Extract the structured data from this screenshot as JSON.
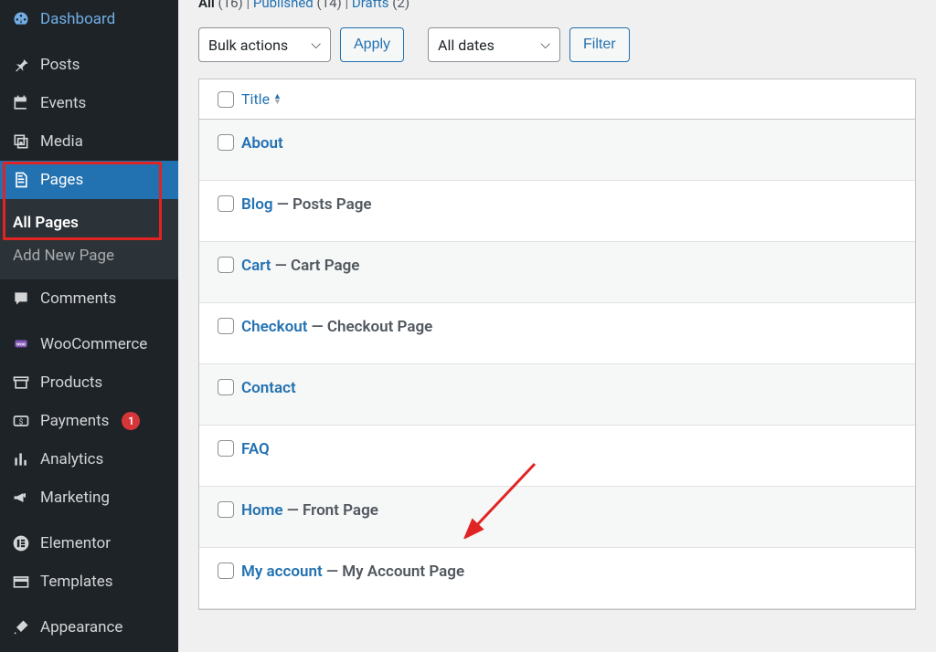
{
  "sidebar": {
    "items": [
      {
        "id": "dashboard",
        "label": "Dashboard",
        "icon": "gauge"
      },
      {
        "id": "posts",
        "label": "Posts",
        "icon": "pin"
      },
      {
        "id": "events",
        "label": "Events",
        "icon": "calendar"
      },
      {
        "id": "media",
        "label": "Media",
        "icon": "media"
      },
      {
        "id": "pages",
        "label": "Pages",
        "icon": "pages"
      },
      {
        "id": "comments",
        "label": "Comments",
        "icon": "comment"
      },
      {
        "id": "woocommerce",
        "label": "WooCommerce",
        "icon": "woo"
      },
      {
        "id": "products",
        "label": "Products",
        "icon": "archive"
      },
      {
        "id": "payments",
        "label": "Payments",
        "icon": "payments",
        "badge": "1"
      },
      {
        "id": "analytics",
        "label": "Analytics",
        "icon": "analytics"
      },
      {
        "id": "marketing",
        "label": "Marketing",
        "icon": "megaphone"
      },
      {
        "id": "elementor",
        "label": "Elementor",
        "icon": "elementor"
      },
      {
        "id": "templates",
        "label": "Templates",
        "icon": "templates"
      },
      {
        "id": "appearance",
        "label": "Appearance",
        "icon": "brush"
      }
    ],
    "submenu": {
      "all_pages": "All Pages",
      "add_new": "Add New Page"
    }
  },
  "filters": {
    "all_label": "All",
    "all_count": "(16)",
    "published_label": "Published",
    "published_count": "(14)",
    "drafts_label": "Drafts",
    "drafts_count": "(2)",
    "sep": " | "
  },
  "controls": {
    "bulk_actions": "Bulk actions",
    "apply": "Apply",
    "all_dates": "All dates",
    "filter": "Filter"
  },
  "table": {
    "title_col": "Title",
    "rows": [
      {
        "title": "About",
        "suffix": ""
      },
      {
        "title": "Blog",
        "suffix": " — Posts Page"
      },
      {
        "title": "Cart",
        "suffix": " — Cart Page"
      },
      {
        "title": "Checkout",
        "suffix": " — Checkout Page"
      },
      {
        "title": "Contact",
        "suffix": ""
      },
      {
        "title": "FAQ",
        "suffix": ""
      },
      {
        "title": "Home",
        "suffix": " — Front Page"
      },
      {
        "title": "My account",
        "suffix": " — My Account Page"
      }
    ]
  }
}
